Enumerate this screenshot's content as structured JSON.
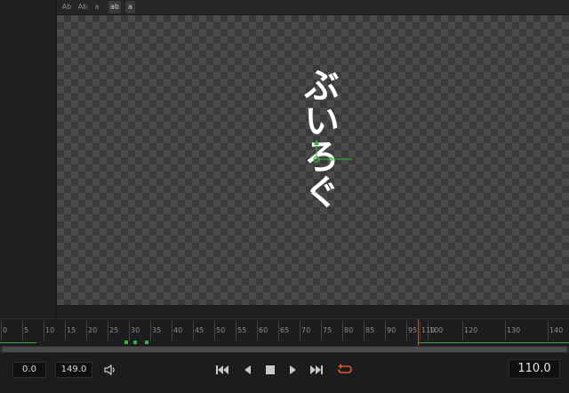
{
  "tool_strip": {
    "buttons": [
      {
        "name": "text-tool-ab-1",
        "label": "Ab"
      },
      {
        "name": "text-tool-ab-2",
        "label": "Ab"
      },
      {
        "name": "text-tool-a",
        "label": "a"
      },
      {
        "name": "text-tool-ab-highlight",
        "label": "ab"
      },
      {
        "name": "text-tool-a-highlight",
        "label": "a"
      }
    ]
  },
  "viewer": {
    "text": "ぶいろぐ",
    "background": "checkerboard"
  },
  "ruler": {
    "labels": [
      "0",
      "5",
      "10",
      "15",
      "20",
      "25",
      "30",
      "35",
      "40",
      "45",
      "50",
      "55",
      "60",
      "65",
      "70",
      "75",
      "80",
      "85",
      "90",
      "95",
      "100",
      "110",
      "120",
      "130",
      "140"
    ],
    "playhead_frame": 110,
    "render_range_color": "#3fae3f",
    "playhead_color": "#d04a3a"
  },
  "transport": {
    "start_time": "0.0",
    "end_time": "149.0",
    "current_time": "110.0",
    "icons": {
      "audio": "speaker-icon",
      "first": "go-to-start-icon",
      "back": "play-reverse-icon",
      "stop": "stop-icon",
      "play": "play-icon",
      "last": "go-to-end-icon",
      "loop": "loop-icon"
    },
    "loop_color": "#e0562e"
  }
}
